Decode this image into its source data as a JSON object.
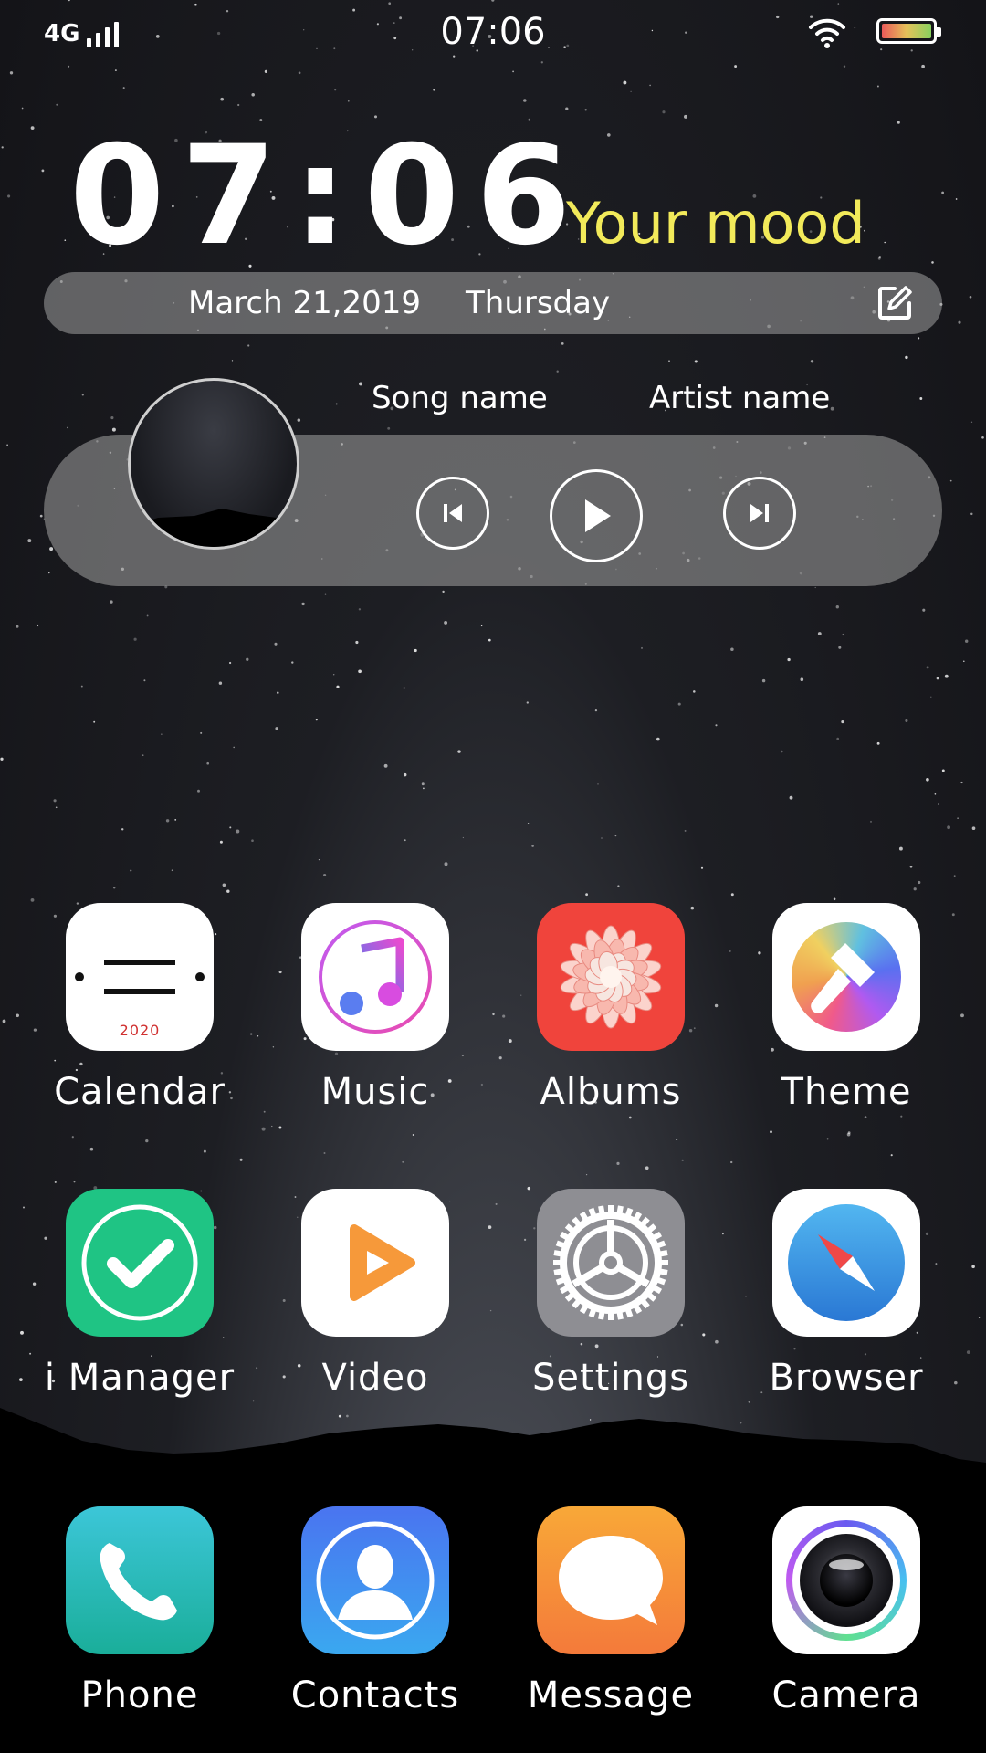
{
  "status_bar": {
    "network": "4G",
    "time": "07:06"
  },
  "clock_widget": {
    "time": "07:06",
    "mood": "Your mood",
    "date": "March 21,2019",
    "weekday": "Thursday"
  },
  "music_widget": {
    "song": "Song name",
    "artist": "Artist name"
  },
  "apps": {
    "calendar": {
      "label": "Calendar",
      "year": "2020"
    },
    "music": {
      "label": "Music"
    },
    "albums": {
      "label": "Albums"
    },
    "theme": {
      "label": "Theme"
    },
    "imanager": {
      "label": "i Manager"
    },
    "video": {
      "label": "Video"
    },
    "settings": {
      "label": "Settings"
    },
    "browser": {
      "label": "Browser"
    }
  },
  "dock": {
    "phone": {
      "label": "Phone"
    },
    "contacts": {
      "label": "Contacts"
    },
    "message": {
      "label": "Message"
    },
    "camera": {
      "label": "Camera"
    }
  },
  "colors": {
    "mood": "#f2ea5a",
    "albums_bg": "#f0443c",
    "imanager_bg": "#1fc484",
    "settings_bg": "#8e8e93"
  }
}
